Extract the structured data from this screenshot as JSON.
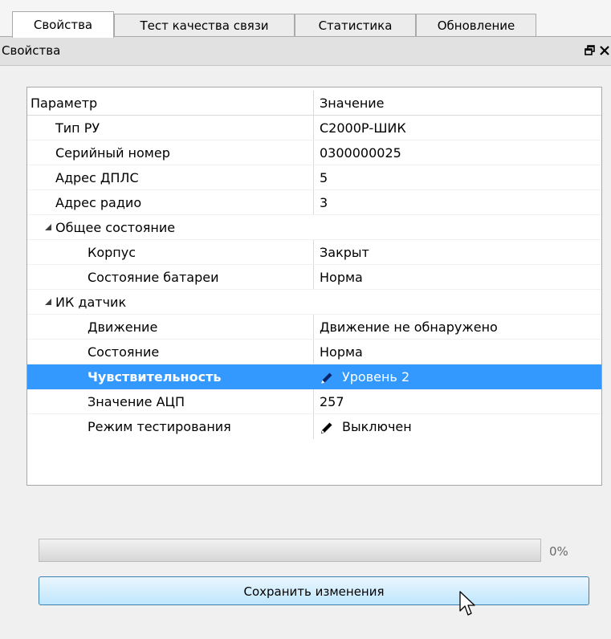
{
  "tabs": [
    {
      "label": "Свойства",
      "active": true
    },
    {
      "label": "Тест качества связи",
      "active": false
    },
    {
      "label": "Статистика",
      "active": false
    },
    {
      "label": "Обновление",
      "active": false
    }
  ],
  "panel": {
    "title": "Свойства",
    "icons": [
      "restore-icon",
      "close-icon"
    ]
  },
  "grid": {
    "header": {
      "param": "Параметр",
      "value": "Значение"
    },
    "rows": [
      {
        "name": "Тип РУ",
        "value": "С2000Р-ШИК"
      },
      {
        "name": "Серийный номер",
        "value": "0300000025"
      },
      {
        "name": "Адрес ДПЛС",
        "value": "5"
      },
      {
        "name": "Адрес радио",
        "value": "3"
      },
      {
        "name": "Общее состояние",
        "group": true
      },
      {
        "name": "Корпус",
        "value": "Закрыт"
      },
      {
        "name": "Состояние батареи",
        "value": "Норма"
      },
      {
        "name": "ИК датчик",
        "group": true
      },
      {
        "name": "Движение",
        "value": "Движение не обнаружено"
      },
      {
        "name": "Состояние",
        "value": "Норма"
      },
      {
        "name": "Чувствительность",
        "value": "Уровень 2",
        "editable": true,
        "selected": true
      },
      {
        "name": "Значение АЦП",
        "value": "257"
      },
      {
        "name": "Режим тестирования",
        "value": "Выключен",
        "editable": true
      }
    ]
  },
  "progress": {
    "value": 0,
    "label": "0%"
  },
  "save_button": {
    "label": "Сохранить изменения"
  },
  "colors": {
    "selection": "#3399ff",
    "button_border": "#3c7fb1"
  }
}
